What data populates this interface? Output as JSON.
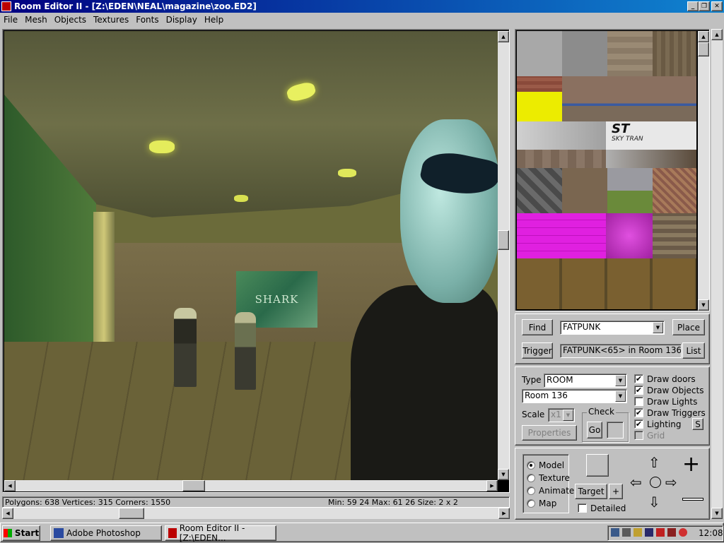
{
  "window": {
    "title": "Room Editor II - [Z:\\EDEN\\NEAL\\magazine\\zoo.ED2]"
  },
  "menu": [
    "File",
    "Mesh",
    "Objects",
    "Textures",
    "Fonts",
    "Display",
    "Help"
  ],
  "viewport": {
    "poster_text": "SHARK"
  },
  "textures": {
    "sky_logo": "ST",
    "sky_label": "SKY TRAN"
  },
  "search": {
    "find_label": "Find",
    "object_value": "FATPUNK",
    "place_label": "Place",
    "trigger_label": "Trigger",
    "result_text": "FATPUNK<65> in Room 136",
    "list_label": "List"
  },
  "settings": {
    "type_label": "Type",
    "type_value": "ROOM",
    "room_value": "Room 136",
    "scale_label": "Scale",
    "scale_value": "x1",
    "check_label": "Check",
    "go_label": "Go",
    "properties_label": "Properties",
    "draw_doors": "Draw doors",
    "draw_objects": "Draw Objects",
    "draw_lights": "Draw Lights",
    "draw_triggers": "Draw Triggers",
    "lighting": "Lighting",
    "lighting_btn": "S",
    "grid": "Grid"
  },
  "mode": {
    "model": "Model",
    "texture": "Texture",
    "animate": "Animate",
    "map": "Map",
    "target_label": "Target",
    "plus_label": "+",
    "detailed_label": "Detailed"
  },
  "status": {
    "left": "Polygons: 638  Vertices: 315  Corners: 1550",
    "right": "Min: 59 24  Max: 61 26  Size: 2 x 2"
  },
  "taskbar": {
    "start": "Start",
    "task1": "Adobe Photoshop",
    "task2": "Room Editor II - [Z:\\EDEN...",
    "clock": "12:08"
  },
  "colors": {
    "title_start": "#000080",
    "title_end": "#1084d0",
    "desktop_gray": "#c0c0c0"
  }
}
